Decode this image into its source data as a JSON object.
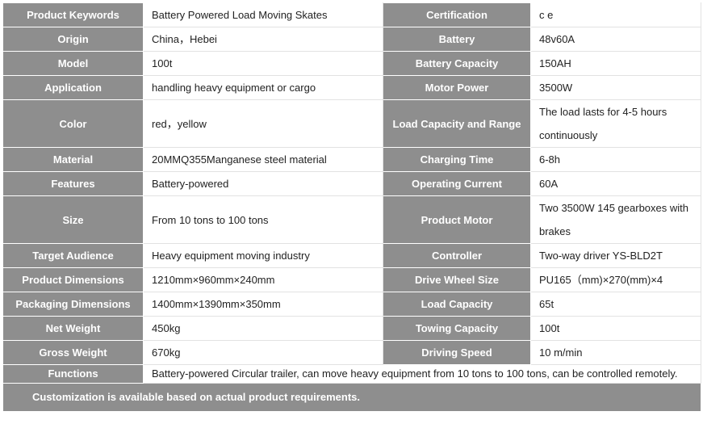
{
  "rows": [
    {
      "k1": "Product Keywords",
      "v1": "Battery Powered Load Moving Skates",
      "k2": "Certification",
      "v2": "c e"
    },
    {
      "k1": "Origin",
      "v1": "China，Hebei",
      "k2": "Battery",
      "v2": "48v60A"
    },
    {
      "k1": "Model",
      "v1": "100t",
      "k2": "Battery Capacity",
      "v2": "150AH"
    },
    {
      "k1": "Application",
      "v1": "handling heavy equipment or cargo",
      "k2": "Motor Power",
      "v2": "3500W"
    },
    {
      "k1": "Color",
      "v1": "red，yellow",
      "k2": "Load Capacity and Range",
      "v2": "The load lasts for 4-5 hours continuously"
    },
    {
      "k1": "Material",
      "v1": "20MMQ355Manganese steel material",
      "k2": "Charging Time",
      "v2": "6-8h"
    },
    {
      "k1": "Features",
      "v1": "Battery-powered",
      "k2": "Operating Current",
      "v2": "60A"
    },
    {
      "k1": "Size",
      "v1": "From 10 tons to 100 tons",
      "k2": "Product Motor",
      "v2": "Two 3500W 145 gearboxes with brakes"
    },
    {
      "k1": "Target Audience",
      "v1": "Heavy equipment moving industry",
      "k2": "Controller",
      "v2": "Two-way driver YS-BLD2T"
    },
    {
      "k1": "Product Dimensions",
      "v1": "1210mm×960mm×240mm",
      "k2": "Drive Wheel Size",
      "v2": "PU165（mm)×270(mm)×4"
    },
    {
      "k1": "Packaging Dimensions",
      "v1": "1400mm×1390mm×350mm",
      "k2": "Load Capacity",
      "v2": "65t"
    },
    {
      "k1": "Net Weight",
      "v1": "450kg",
      "k2": "Towing Capacity",
      "v2": "100t"
    },
    {
      "k1": "Gross Weight",
      "v1": "670kg",
      "k2": "Driving Speed",
      "v2": "10 m/min"
    }
  ],
  "functions": {
    "label": "Functions",
    "value": "Battery-powered Circular trailer, can move heavy equipment from 10 tons to 100 tons, can be controlled remotely."
  },
  "customization": "Customization is available based on actual product requirements.",
  "colors": {
    "header_bg": "#8e8e8e",
    "header_text": "#ffffff",
    "value_bg": "#ffffff",
    "value_text": "#222222"
  }
}
